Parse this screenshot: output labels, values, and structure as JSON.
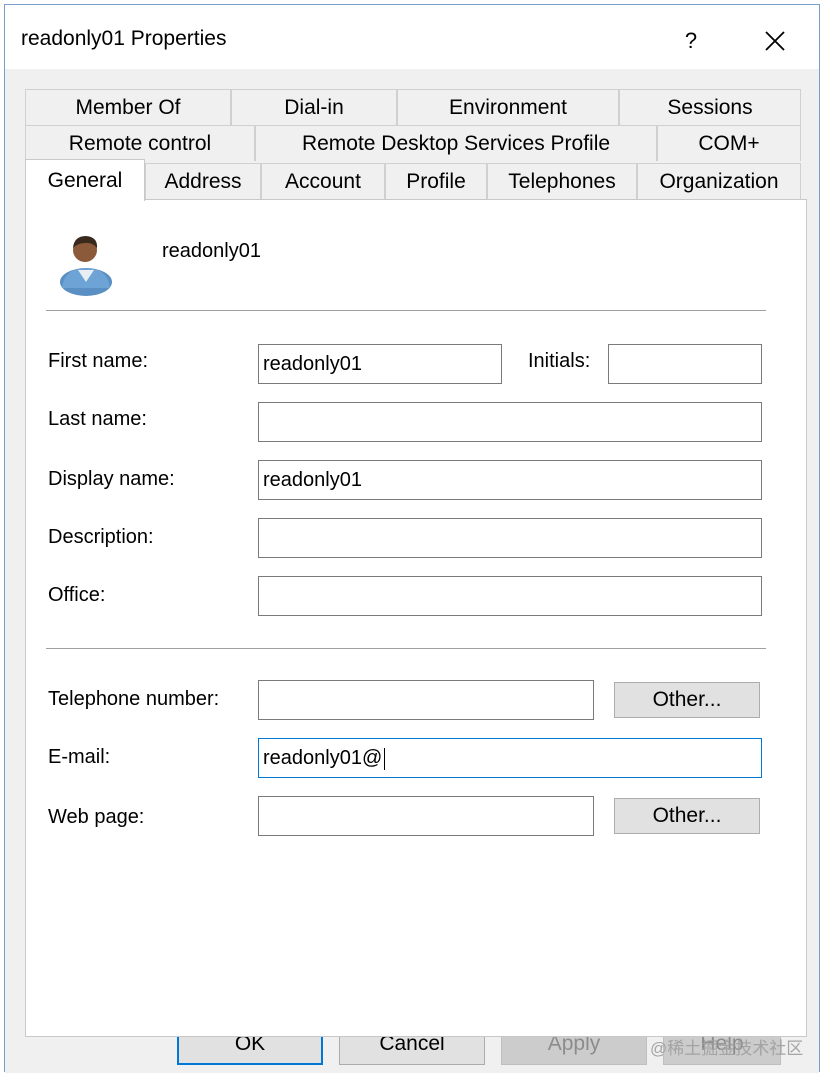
{
  "window": {
    "title": "readonly01 Properties",
    "help_glyph": "?"
  },
  "tabs": {
    "row1": [
      "Member Of",
      "Dial-in",
      "Environment",
      "Sessions"
    ],
    "row2": [
      "Remote control",
      "Remote Desktop Services Profile",
      "COM+"
    ],
    "row3": [
      "General",
      "Address",
      "Account",
      "Profile",
      "Telephones",
      "Organization"
    ],
    "selected": "General"
  },
  "general": {
    "username": "readonly01",
    "first_name": {
      "label": "First name:",
      "value": "readonly01"
    },
    "initials": {
      "label": "Initials:",
      "value": ""
    },
    "last_name": {
      "label": "Last name:",
      "value": ""
    },
    "display_name": {
      "label": "Display name:",
      "value": "readonly01"
    },
    "description": {
      "label": "Description:",
      "value": ""
    },
    "office": {
      "label": "Office:",
      "value": ""
    },
    "telephone": {
      "label": "Telephone number:",
      "value": "",
      "other_label": "Other..."
    },
    "email": {
      "label": "E-mail:",
      "value": "readonly01@"
    },
    "web_page": {
      "label": "Web page:",
      "value": "",
      "other_label": "Other..."
    }
  },
  "buttons": {
    "ok": "OK",
    "cancel": "Cancel",
    "apply": "Apply",
    "help": "Help"
  },
  "watermark": "@稀土掘金技术社区",
  "colors": {
    "focus": "#0078d7",
    "window_border": "#7a9cc8",
    "client_bg": "#f0f0f0"
  }
}
